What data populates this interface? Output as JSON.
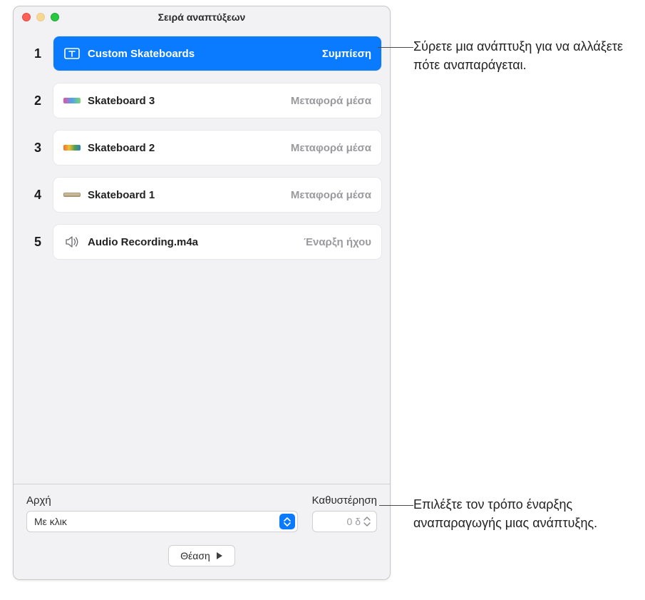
{
  "window": {
    "title": "Σειρά αναπτύξεων"
  },
  "rows": [
    {
      "index": "1",
      "name": "Custom Skateboards",
      "effect": "Συμπίεση",
      "selected": true,
      "iconType": "textbox"
    },
    {
      "index": "2",
      "name": "Skateboard 3",
      "effect": "Μεταφορά μέσα",
      "selected": false,
      "iconType": "thumb1"
    },
    {
      "index": "3",
      "name": "Skateboard 2",
      "effect": "Μεταφορά μέσα",
      "selected": false,
      "iconType": "thumb2"
    },
    {
      "index": "4",
      "name": "Skateboard 1",
      "effect": "Μεταφορά μέσα",
      "selected": false,
      "iconType": "thumb3"
    },
    {
      "index": "5",
      "name": "Audio Recording.m4a",
      "effect": "Έναρξη ήχου",
      "selected": false,
      "iconType": "audio"
    }
  ],
  "footer": {
    "start_label": "Αρχή",
    "start_value": "Με κλικ",
    "delay_label": "Καθυστέρηση",
    "delay_value": "0 δ",
    "play_label": "Θέαση"
  },
  "callouts": {
    "drag": "Σύρετε μια ανάπτυξη για να αλλάξετε πότε αναπαράγεται.",
    "start": "Επιλέξτε τον τρόπο έναρξης αναπαραγωγής μιας ανάπτυξης."
  }
}
